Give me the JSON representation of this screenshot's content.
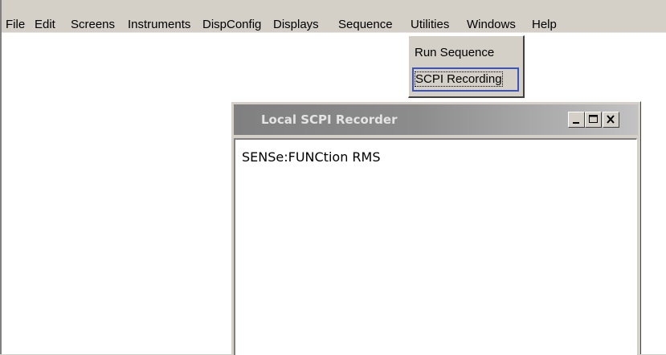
{
  "menubar": {
    "items": [
      "File",
      "Edit",
      "Screens",
      "Instruments",
      "DispConfig",
      "Displays",
      "Sequence",
      "Utilities",
      "Windows",
      "Help"
    ]
  },
  "sequence_menu": {
    "items": [
      "Run Sequence",
      "SCPI Recording"
    ],
    "selected": "SCPI Recording"
  },
  "recorder_window": {
    "title": "Local SCPI Recorder",
    "content": "SENSe:FUNCtion RMS",
    "buttons": {
      "minimize": "minimize-icon",
      "maximize": "maximize-icon",
      "close": "close-icon"
    }
  }
}
